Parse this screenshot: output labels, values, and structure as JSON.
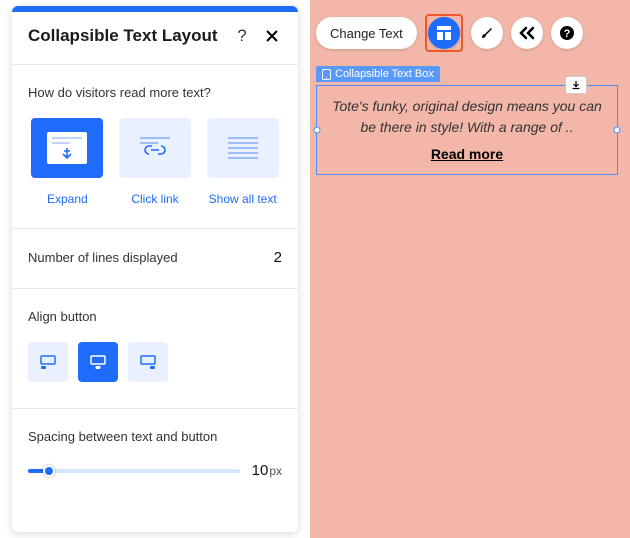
{
  "panel": {
    "title": "Collapsible Text Layout",
    "readModes": {
      "label": "How do visitors read more text?",
      "options": [
        {
          "label": "Expand",
          "selected": true
        },
        {
          "label": "Click link",
          "selected": false
        },
        {
          "label": "Show all text",
          "selected": false
        }
      ]
    },
    "lines": {
      "label": "Number of lines displayed",
      "value": "2"
    },
    "align": {
      "label": "Align button",
      "selected": 1
    },
    "spacing": {
      "label": "Spacing between text and button",
      "value": "10",
      "unit": "px",
      "percent": 10
    }
  },
  "canvas": {
    "toolbar": {
      "changeText": "Change Text"
    },
    "component": {
      "tag": "Collapsible Text Box",
      "text": "Tote's funky, original design means you can be there in style! With a range of ..",
      "linkLabel": "Read more"
    }
  },
  "colors": {
    "accent": "#1f6cfb"
  }
}
